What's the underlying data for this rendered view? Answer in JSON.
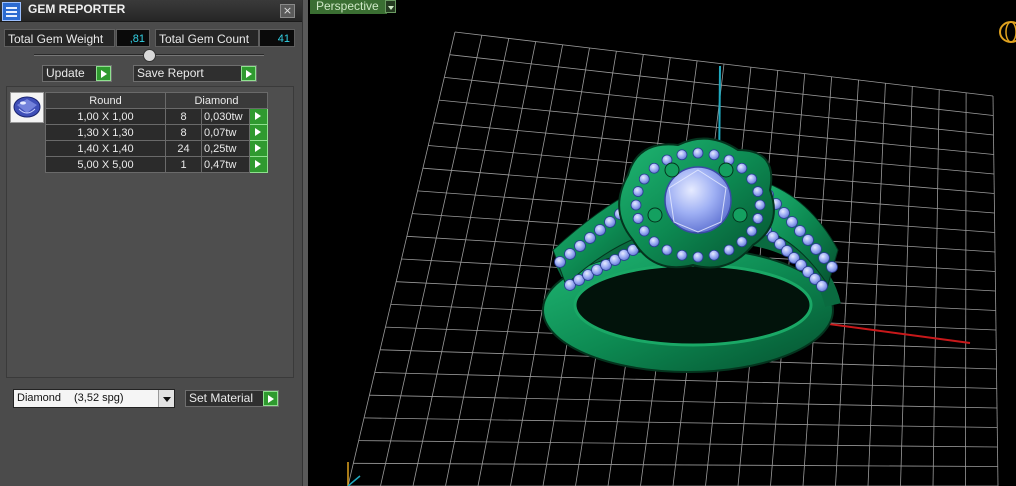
{
  "window": {
    "title": "GEM REPORTER",
    "close_glyph": "×",
    "icon": "gem-reporter-app-icon"
  },
  "stats": {
    "total_weight_label": "Total Gem Weight",
    "total_weight_value": ",81",
    "total_count_label": "Total Gem Count",
    "total_count_value": "41"
  },
  "actions": {
    "update_label": "Update",
    "save_report_label": "Save Report"
  },
  "gem_list": {
    "shape_header": "Round",
    "material_header": "Diamond",
    "rows": [
      {
        "size": "1,00 X 1,00",
        "count": "8",
        "weight": "0,030tw"
      },
      {
        "size": "1,30 X 1,30",
        "count": "8",
        "weight": "0,07tw"
      },
      {
        "size": "1,40 X 1,40",
        "count": "24",
        "weight": "0,25tw"
      },
      {
        "size": "5,00 X 5,00",
        "count": "1",
        "weight": "0,47tw"
      }
    ]
  },
  "material": {
    "selected_name": "Diamond",
    "selected_density": "(3,52 spg)",
    "set_label": "Set Material"
  },
  "viewport": {
    "view_label": "Perspective"
  },
  "colors": {
    "ring_metal": "#0d8a52",
    "gem": "#8fa3ee",
    "grid": "#9a9a9a",
    "axis_x": "#c8181a",
    "axis_y": "#1fa9bf",
    "accent_green": "#2f9a2f",
    "value_cyan": "#34d2e6"
  }
}
